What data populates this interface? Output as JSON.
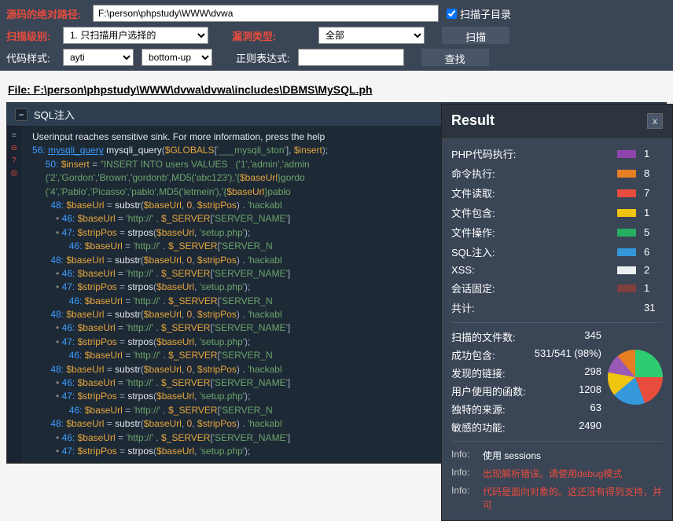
{
  "topbar": {
    "path_label": "源码的绝对路径:",
    "path_value": "F:\\person\\phpstudy\\WWW\\dvwa",
    "scan_sub_label": "扫描子目录",
    "scan_level_label": "扫描级别:",
    "scan_level_value": "1. 只扫描用户选择的",
    "vuln_type_label": "漏洞类型:",
    "vuln_type_value": "全部",
    "scan_btn": "扫描",
    "code_style_label": "代码样式:",
    "code_style_value": "ayti",
    "direction_value": "bottom-up",
    "regex_label": "正则表达式:",
    "regex_value": "",
    "search_btn": "查找"
  },
  "file_title": "File: F:\\person\\phpstudy\\WWW\\dvwa\\dvwa\\includes\\DBMS\\MySQL.ph",
  "code_header": "SQL注入",
  "help_line": "Userinput reaches sensitive sink. For more information, press the help",
  "result": {
    "title": "Result",
    "stats": [
      {
        "label": "PHP代码执行:",
        "color": "#8e44ad",
        "value": "1"
      },
      {
        "label": "命令执行:",
        "color": "#e67e22",
        "value": "8"
      },
      {
        "label": "文件读取:",
        "color": "#e74c3c",
        "value": "7"
      },
      {
        "label": "文件包含:",
        "color": "#f1c40f",
        "value": "1"
      },
      {
        "label": "文件操作:",
        "color": "#27ae60",
        "value": "5"
      },
      {
        "label": "SQL注入:",
        "color": "#3498db",
        "value": "6"
      },
      {
        "label": "XSS:",
        "color": "#ecf0f1",
        "value": "2"
      },
      {
        "label": "会话固定:",
        "color": "#7f3f3f",
        "value": "1"
      },
      {
        "label": "共计:",
        "color": "",
        "value": "31"
      }
    ],
    "info_stats": [
      {
        "label": "扫描的文件数:",
        "value": "345"
      },
      {
        "label": "成功包含:",
        "value": "531/541 (98%)"
      },
      {
        "label": "发现的链接:",
        "value": "298"
      },
      {
        "label": "用户使用的函数:",
        "value": "1208"
      },
      {
        "label": "独特的来源:",
        "value": "63"
      },
      {
        "label": "敏感的功能:",
        "value": "2490"
      }
    ],
    "msgs": [
      {
        "key": "Info:",
        "white": "使用 sessions"
      },
      {
        "key": "Info:",
        "red": "出现解析错误。请使用debug模式"
      },
      {
        "key": "Info:",
        "red": "代码是面向对象的。这还没有得到支持，并可"
      }
    ]
  }
}
